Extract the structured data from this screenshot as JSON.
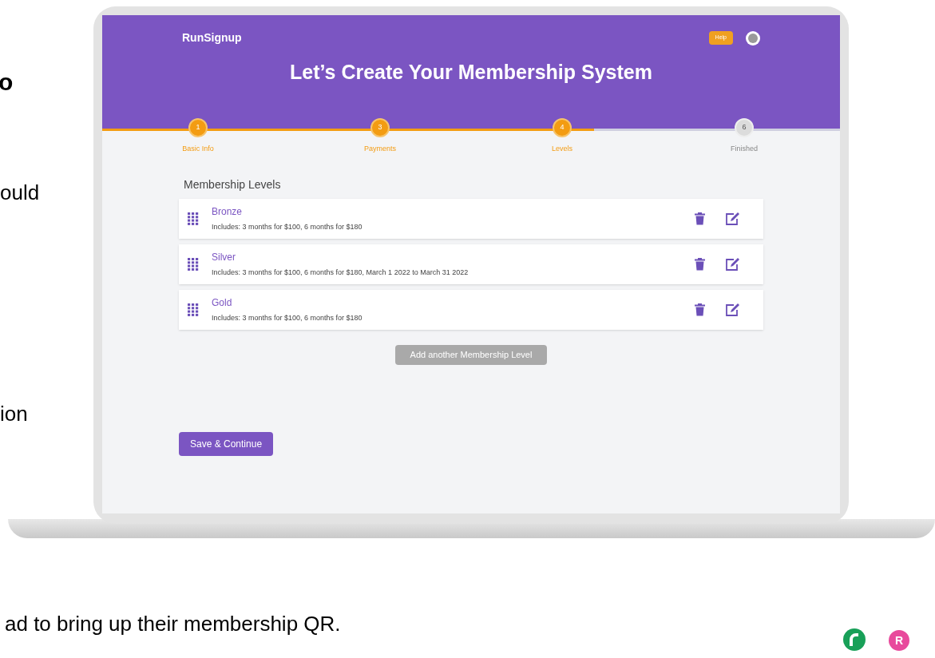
{
  "slide_text": [
    "o",
    "ould",
    "ion",
    "ad to bring up their membership QR."
  ],
  "app": {
    "logo": "RunSignup",
    "help": "Help",
    "title": "Let’s Create Your Membership System",
    "steps": [
      {
        "number": "1",
        "label": "Basic Info",
        "completed": true
      },
      {
        "number": "3",
        "label": "Payments",
        "completed": true
      },
      {
        "number": "4",
        "label": "Levels",
        "completed": true
      },
      {
        "number": "6",
        "label": "Finished",
        "completed": false
      }
    ],
    "section_title": "Membership Levels",
    "levels": [
      {
        "name": "Bronze",
        "description": "Includes: 3 months for $100, 6 months for $180"
      },
      {
        "name": "Silver",
        "description": "Includes: 3 months for $100, 6 months for $180, March 1 2022 to March 31 2022"
      },
      {
        "name": "Gold",
        "description": "Includes: 3 months for $100, 6 months for $180"
      }
    ],
    "add_button": "Add another Membership Level",
    "save_button": "Save & Continue"
  },
  "footer_badge": "R"
}
